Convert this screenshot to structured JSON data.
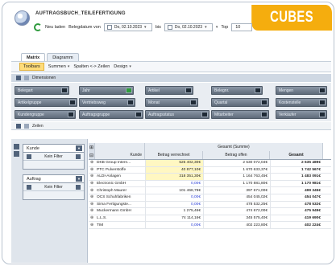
{
  "badge": "CUBES",
  "app": {
    "title": "AUFTRAGSBUCH_TEILEFERTIGUNG"
  },
  "toolbar": {
    "reload_label": "Neu laden",
    "date_label": "Belegdatum von",
    "date_from": "Do, 02.10.2023",
    "to_label": "bis",
    "date_to": "Do, 02.10.2023",
    "top_label": "Top",
    "top_value": "10"
  },
  "tabs": [
    {
      "label": "Matrix",
      "active": true
    },
    {
      "label": "Diagramm",
      "active": false
    }
  ],
  "ribbon": {
    "toolbars": "Toolbars",
    "summen": "Summen",
    "swap": "Spalten <-> Zeilen",
    "design": "Design"
  },
  "dimensions": {
    "label": "Dimensionen",
    "pills": [
      {
        "label": "Belegart"
      },
      {
        "label": "Jahr"
      },
      {
        "label": "Artikel"
      },
      {
        "label": "Belegnr."
      },
      {
        "label": "Mengen"
      },
      {
        "label": "Artikelgruppe"
      },
      {
        "label": "Vertriebsweg"
      },
      {
        "label": "Monat"
      },
      {
        "label": "Quartal"
      },
      {
        "label": "Kostenstelle"
      },
      {
        "label": "Kundengruppe"
      },
      {
        "label": "Auftragsgruppe"
      },
      {
        "label": "Auftragsstatus"
      },
      {
        "label": "Mitarbeiter"
      },
      {
        "label": "Verkäufer"
      }
    ]
  },
  "rows_bar": {
    "label": "Zeilen"
  },
  "filters": [
    {
      "name": "Kunde",
      "filter": "Kein Filter"
    },
    {
      "name": "Auftrag",
      "filter": "Kein Filter"
    }
  ],
  "grid": {
    "group_header": "Gesamt (Summe)",
    "row_header": "Kunde",
    "columns": [
      "Betrag verrechnet",
      "Betrag offen",
      "Gesamt"
    ],
    "rows": [
      {
        "name": "DKB Group Intern...",
        "c1": "525 402,30€",
        "c2": "2 530 072,04€",
        "c3": "2 635 489€"
      },
      {
        "name": "PTC Pulverstoffe",
        "c1": "40 877,10€",
        "c2": "1 670 633,37€",
        "c3": "1 742 567€"
      },
      {
        "name": "ALDI-Anlagen",
        "c1": "318 351,30€",
        "c2": "1 164 763,45€",
        "c3": "1 483 091€"
      },
      {
        "name": "Electronic GmbH",
        "c1": "0,00€",
        "c2": "1 170 881,80€",
        "c3": "1 170 981€"
      },
      {
        "name": "Christoph Maurer",
        "c1": "101 468,79€",
        "c2": "397 671,00€",
        "c3": "499 345€"
      },
      {
        "name": "OCS Schuhfabriken",
        "c1": "0,00€",
        "c2": "454 045,02€",
        "c3": "454 047€"
      },
      {
        "name": "Sima Fertigungste...",
        "c1": "0,00€",
        "c2": "478 532,25€",
        "c3": "478 532€"
      },
      {
        "name": "Muckermann GmbH",
        "c1": "1 275,46€",
        "c2": "474 672,00€",
        "c3": "475 949€"
      },
      {
        "name": "L.L.S.",
        "c1": "74 114,16€",
        "c2": "345 575,40€",
        "c3": "419 690€"
      },
      {
        "name": "TIM",
        "c1": "0,00€",
        "c2": "402 223,80€",
        "c3": "402 224€"
      }
    ]
  },
  "colors": {
    "badge": "#f5ad0e",
    "pill": "#6b7787",
    "accent_green": "#2f9d3c",
    "value_blue": "#2b3fd6"
  }
}
